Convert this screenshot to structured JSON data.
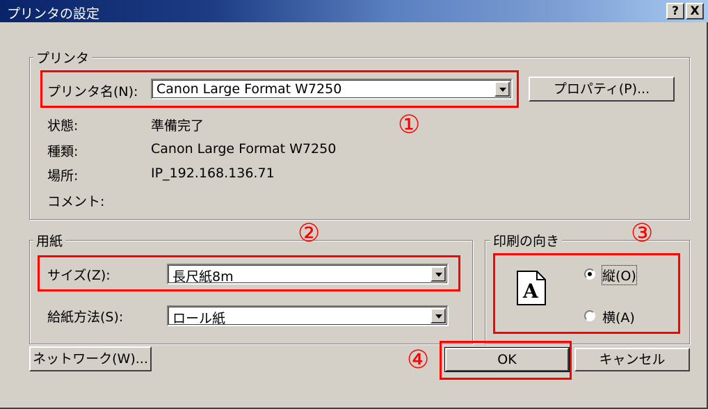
{
  "window": {
    "title": "プリンタの設定",
    "help_btn": "?",
    "close_btn": "X"
  },
  "printer": {
    "group_label": "プリンタ",
    "name_label": "プリンタ名(N):",
    "name_value": "Canon Large Format W7250",
    "properties_btn": "プロパティ(P)...",
    "status_label": "状態:",
    "status_value": "準備完了",
    "type_label": "種類:",
    "type_value": "Canon Large Format W7250",
    "location_label": "場所:",
    "location_value": "IP_192.168.136.71",
    "comment_label": "コメント:",
    "comment_value": ""
  },
  "paper": {
    "group_label": "用紙",
    "size_label": "サイズ(Z):",
    "size_value": "長尺紙8m",
    "source_label": "給紙方法(S):",
    "source_value": "ロール紙"
  },
  "orientation": {
    "group_label": "印刷の向き",
    "portrait_label": "縦(O)",
    "landscape_label": "横(A)",
    "selected": "portrait",
    "icon_letter": "A"
  },
  "buttons": {
    "network": "ネットワーク(W)...",
    "ok": "OK",
    "cancel": "キャンセル"
  },
  "annotations": {
    "marker1": "①",
    "marker2": "②",
    "marker3": "③",
    "marker4": "④",
    "color": "#ff0000"
  }
}
